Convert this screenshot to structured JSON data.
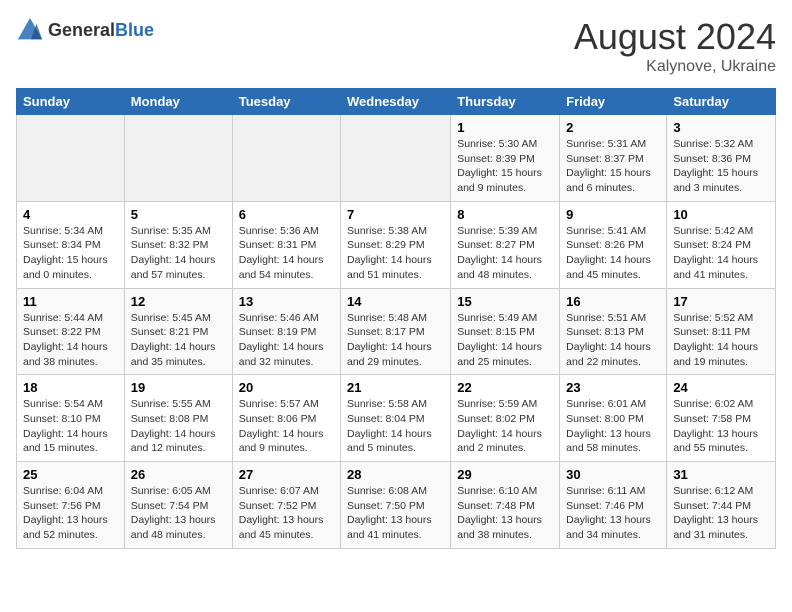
{
  "header": {
    "logo_general": "General",
    "logo_blue": "Blue",
    "title": "August 2024",
    "subtitle": "Kalynove, Ukraine"
  },
  "columns": [
    "Sunday",
    "Monday",
    "Tuesday",
    "Wednesday",
    "Thursday",
    "Friday",
    "Saturday"
  ],
  "weeks": [
    {
      "days": [
        {
          "num": "",
          "info": ""
        },
        {
          "num": "",
          "info": ""
        },
        {
          "num": "",
          "info": ""
        },
        {
          "num": "",
          "info": ""
        },
        {
          "num": "1",
          "info": "Sunrise: 5:30 AM\nSunset: 8:39 PM\nDaylight: 15 hours and 9 minutes."
        },
        {
          "num": "2",
          "info": "Sunrise: 5:31 AM\nSunset: 8:37 PM\nDaylight: 15 hours and 6 minutes."
        },
        {
          "num": "3",
          "info": "Sunrise: 5:32 AM\nSunset: 8:36 PM\nDaylight: 15 hours and 3 minutes."
        }
      ]
    },
    {
      "days": [
        {
          "num": "4",
          "info": "Sunrise: 5:34 AM\nSunset: 8:34 PM\nDaylight: 15 hours and 0 minutes."
        },
        {
          "num": "5",
          "info": "Sunrise: 5:35 AM\nSunset: 8:32 PM\nDaylight: 14 hours and 57 minutes."
        },
        {
          "num": "6",
          "info": "Sunrise: 5:36 AM\nSunset: 8:31 PM\nDaylight: 14 hours and 54 minutes."
        },
        {
          "num": "7",
          "info": "Sunrise: 5:38 AM\nSunset: 8:29 PM\nDaylight: 14 hours and 51 minutes."
        },
        {
          "num": "8",
          "info": "Sunrise: 5:39 AM\nSunset: 8:27 PM\nDaylight: 14 hours and 48 minutes."
        },
        {
          "num": "9",
          "info": "Sunrise: 5:41 AM\nSunset: 8:26 PM\nDaylight: 14 hours and 45 minutes."
        },
        {
          "num": "10",
          "info": "Sunrise: 5:42 AM\nSunset: 8:24 PM\nDaylight: 14 hours and 41 minutes."
        }
      ]
    },
    {
      "days": [
        {
          "num": "11",
          "info": "Sunrise: 5:44 AM\nSunset: 8:22 PM\nDaylight: 14 hours and 38 minutes."
        },
        {
          "num": "12",
          "info": "Sunrise: 5:45 AM\nSunset: 8:21 PM\nDaylight: 14 hours and 35 minutes."
        },
        {
          "num": "13",
          "info": "Sunrise: 5:46 AM\nSunset: 8:19 PM\nDaylight: 14 hours and 32 minutes."
        },
        {
          "num": "14",
          "info": "Sunrise: 5:48 AM\nSunset: 8:17 PM\nDaylight: 14 hours and 29 minutes."
        },
        {
          "num": "15",
          "info": "Sunrise: 5:49 AM\nSunset: 8:15 PM\nDaylight: 14 hours and 25 minutes."
        },
        {
          "num": "16",
          "info": "Sunrise: 5:51 AM\nSunset: 8:13 PM\nDaylight: 14 hours and 22 minutes."
        },
        {
          "num": "17",
          "info": "Sunrise: 5:52 AM\nSunset: 8:11 PM\nDaylight: 14 hours and 19 minutes."
        }
      ]
    },
    {
      "days": [
        {
          "num": "18",
          "info": "Sunrise: 5:54 AM\nSunset: 8:10 PM\nDaylight: 14 hours and 15 minutes."
        },
        {
          "num": "19",
          "info": "Sunrise: 5:55 AM\nSunset: 8:08 PM\nDaylight: 14 hours and 12 minutes."
        },
        {
          "num": "20",
          "info": "Sunrise: 5:57 AM\nSunset: 8:06 PM\nDaylight: 14 hours and 9 minutes."
        },
        {
          "num": "21",
          "info": "Sunrise: 5:58 AM\nSunset: 8:04 PM\nDaylight: 14 hours and 5 minutes."
        },
        {
          "num": "22",
          "info": "Sunrise: 5:59 AM\nSunset: 8:02 PM\nDaylight: 14 hours and 2 minutes."
        },
        {
          "num": "23",
          "info": "Sunrise: 6:01 AM\nSunset: 8:00 PM\nDaylight: 13 hours and 58 minutes."
        },
        {
          "num": "24",
          "info": "Sunrise: 6:02 AM\nSunset: 7:58 PM\nDaylight: 13 hours and 55 minutes."
        }
      ]
    },
    {
      "days": [
        {
          "num": "25",
          "info": "Sunrise: 6:04 AM\nSunset: 7:56 PM\nDaylight: 13 hours and 52 minutes."
        },
        {
          "num": "26",
          "info": "Sunrise: 6:05 AM\nSunset: 7:54 PM\nDaylight: 13 hours and 48 minutes."
        },
        {
          "num": "27",
          "info": "Sunrise: 6:07 AM\nSunset: 7:52 PM\nDaylight: 13 hours and 45 minutes."
        },
        {
          "num": "28",
          "info": "Sunrise: 6:08 AM\nSunset: 7:50 PM\nDaylight: 13 hours and 41 minutes."
        },
        {
          "num": "29",
          "info": "Sunrise: 6:10 AM\nSunset: 7:48 PM\nDaylight: 13 hours and 38 minutes."
        },
        {
          "num": "30",
          "info": "Sunrise: 6:11 AM\nSunset: 7:46 PM\nDaylight: 13 hours and 34 minutes."
        },
        {
          "num": "31",
          "info": "Sunrise: 6:12 AM\nSunset: 7:44 PM\nDaylight: 13 hours and 31 minutes."
        }
      ]
    }
  ]
}
